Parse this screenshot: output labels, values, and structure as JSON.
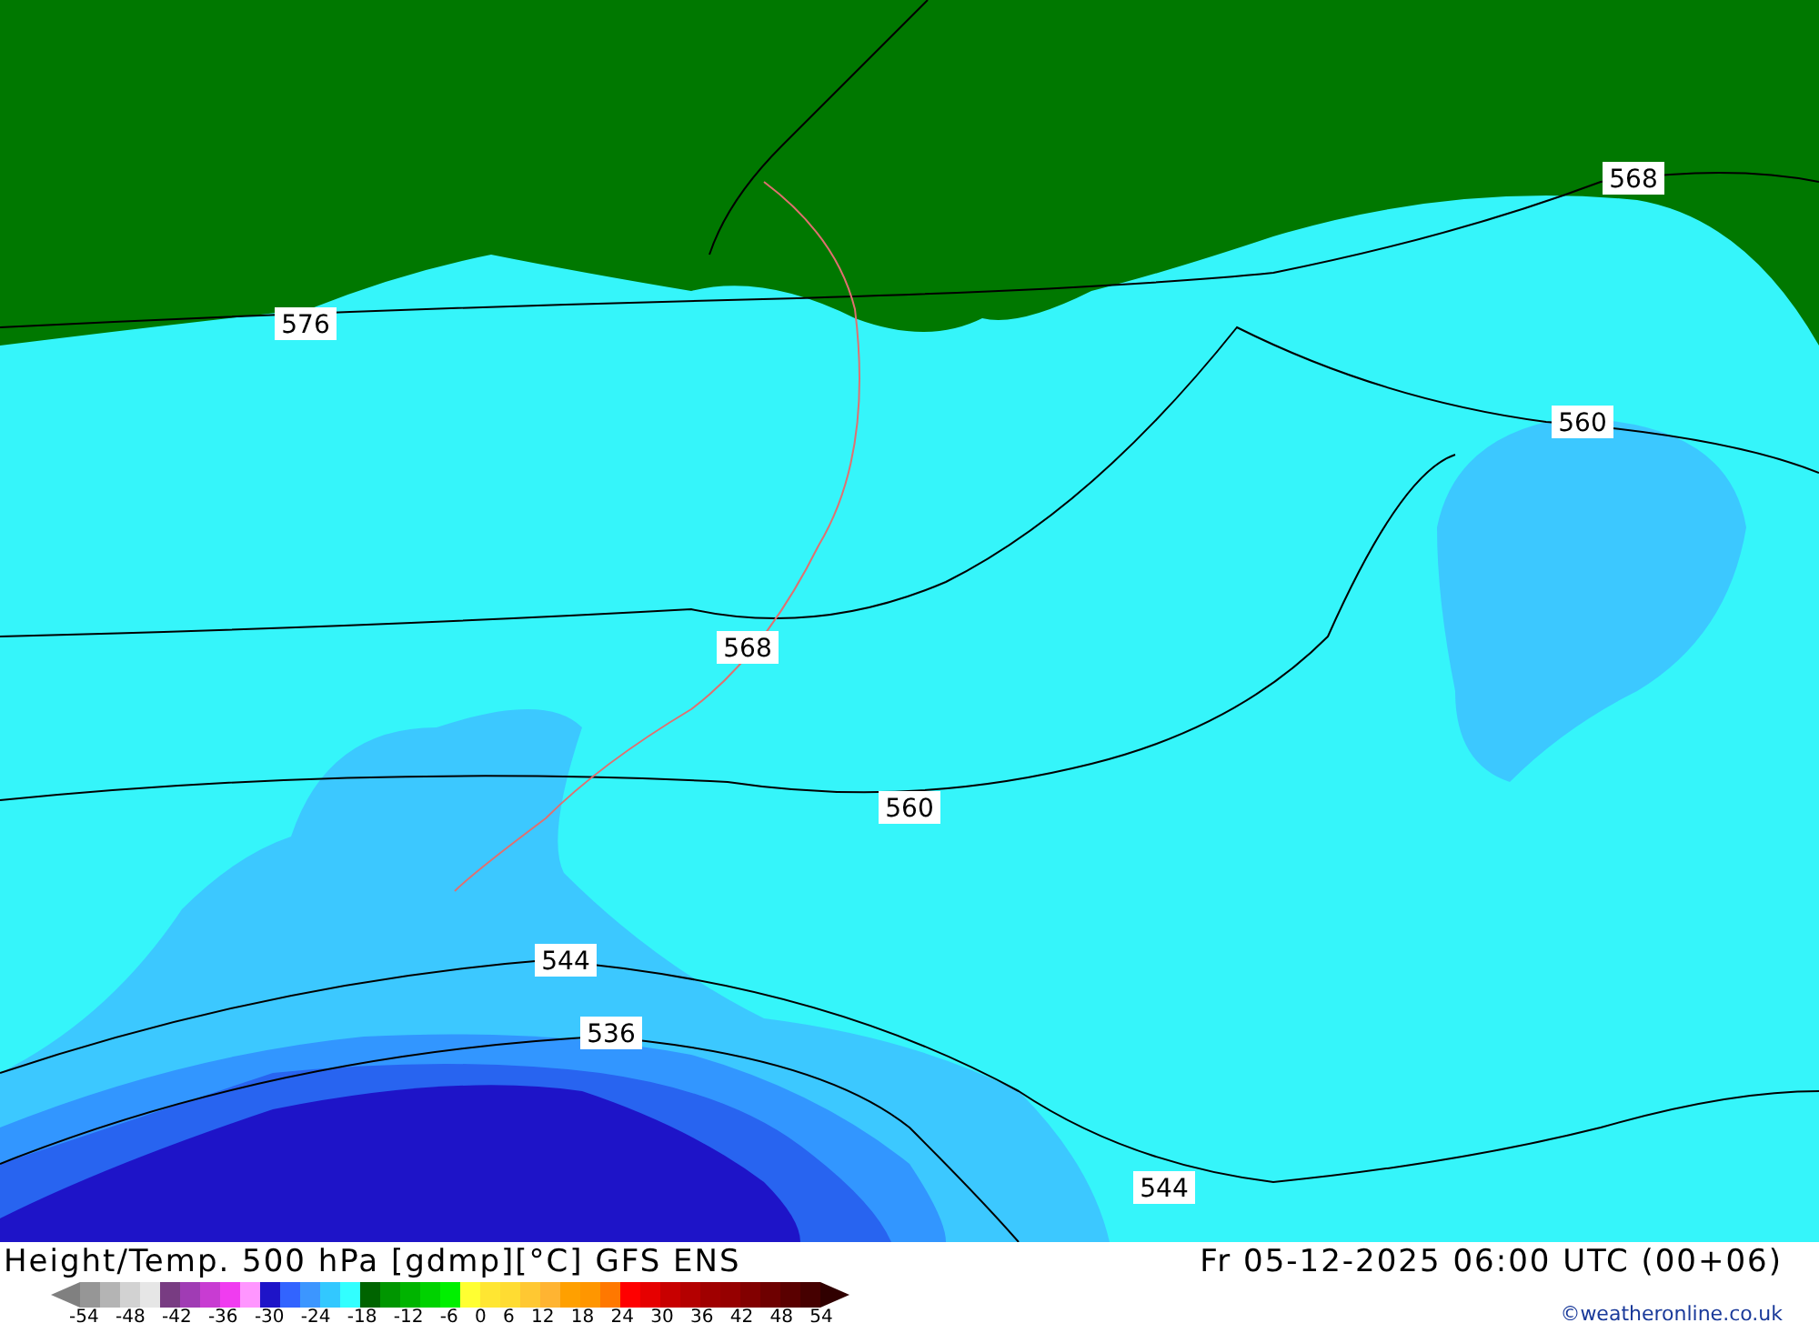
{
  "map": {
    "contour_labels": [
      "576",
      "568",
      "560",
      "568",
      "560",
      "544",
      "536",
      "544"
    ]
  },
  "footer": {
    "title": "Height/Temp. 500 hPa [gdmp][°C] GFS ENS",
    "valid_time": "Fr 05-12-2025 06:00 UTC (00+06)",
    "credit": "©weatheronline.co.uk"
  },
  "legend": {
    "swatches": [
      {
        "color": "#969696"
      },
      {
        "color": "#b4b4b4"
      },
      {
        "color": "#d2d2d2"
      },
      {
        "color": "#e6e6e6"
      },
      {
        "color": "#783c82"
      },
      {
        "color": "#a03cb4"
      },
      {
        "color": "#c83cd2"
      },
      {
        "color": "#f03cf0"
      },
      {
        "color": "#ff96ff"
      },
      {
        "color": "#1e14c8"
      },
      {
        "color": "#3264ff"
      },
      {
        "color": "#3c96ff"
      },
      {
        "color": "#32c8ff"
      },
      {
        "color": "#32ffff"
      },
      {
        "color": "#006400"
      },
      {
        "color": "#009600"
      },
      {
        "color": "#00b400"
      },
      {
        "color": "#00d200"
      },
      {
        "color": "#00f000"
      },
      {
        "color": "#ffff32"
      },
      {
        "color": "#ffe632"
      },
      {
        "color": "#ffdc32"
      },
      {
        "color": "#ffc832"
      },
      {
        "color": "#ffb432"
      },
      {
        "color": "#ffa000"
      },
      {
        "color": "#ff9600"
      },
      {
        "color": "#ff7800"
      },
      {
        "color": "#ff0000"
      },
      {
        "color": "#e60000"
      },
      {
        "color": "#c80000"
      },
      {
        "color": "#b40000"
      },
      {
        "color": "#a00000"
      },
      {
        "color": "#960000"
      },
      {
        "color": "#820000"
      },
      {
        "color": "#6e0000"
      },
      {
        "color": "#5a0000"
      },
      {
        "color": "#460000"
      }
    ],
    "ticks": [
      "-54",
      "-48",
      "-42",
      "-36",
      "-30",
      "-24",
      "-18",
      "-12",
      "-6",
      "0",
      "6",
      "12",
      "18",
      "24",
      "30",
      "36",
      "42",
      "48",
      "54"
    ]
  }
}
